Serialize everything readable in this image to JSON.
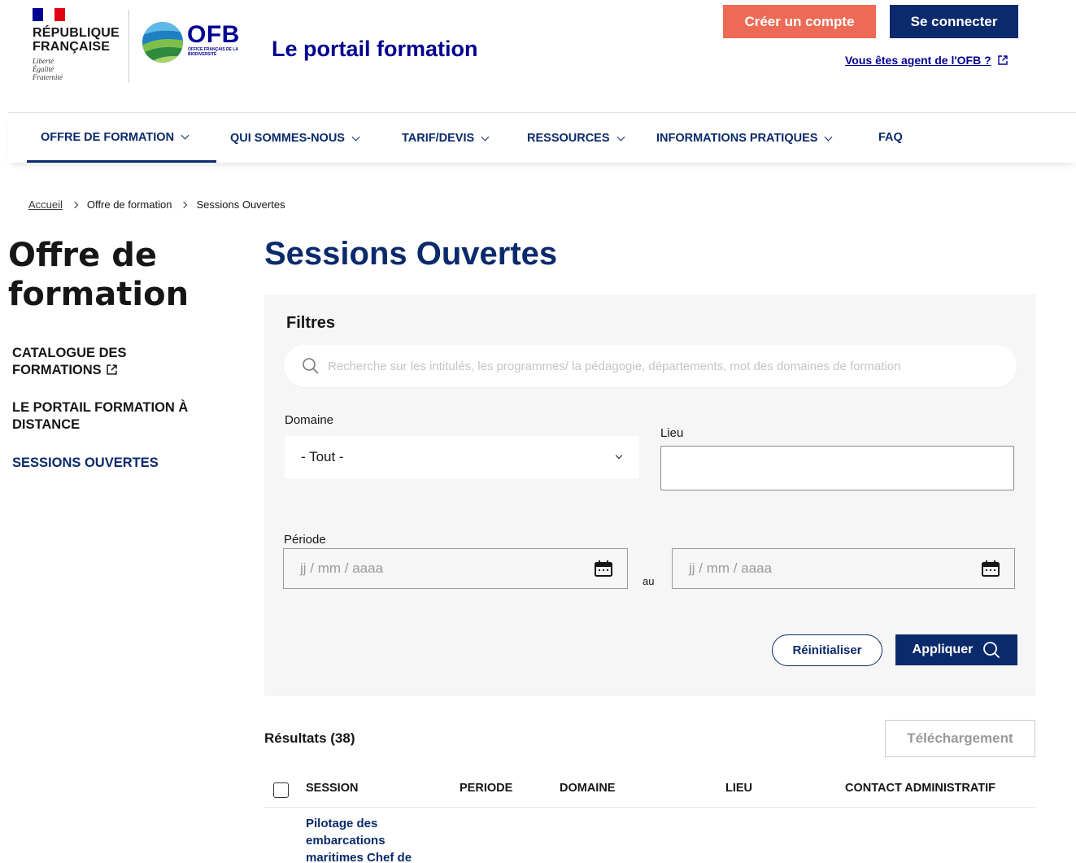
{
  "header": {
    "republique_line1": "RÉPUBLIQUE",
    "republique_line2": "FRANÇAISE",
    "motto_1": "Liberté",
    "motto_2": "Égalité",
    "motto_3": "Fraternité",
    "ofb_logo_text": "OFB",
    "ofb_logo_sub": "Office français de la biodiversité",
    "site_title": "Le portail formation",
    "create_account_label": "Créer un compte",
    "login_label": "Se connecter",
    "agent_link_label": "Vous êtes agent de l'OFB ?"
  },
  "nav": {
    "items": [
      {
        "label": "OFFRE DE FORMATION",
        "has_dropdown": true,
        "active": true
      },
      {
        "label": "QUI SOMMES-NOUS",
        "has_dropdown": true
      },
      {
        "label": "TARIF/DEVIS",
        "has_dropdown": true
      },
      {
        "label": "RESSOURCES",
        "has_dropdown": true
      },
      {
        "label": "INFORMATIONS PRATIQUES",
        "has_dropdown": true
      },
      {
        "label": "FAQ",
        "has_dropdown": false
      }
    ]
  },
  "breadcrumb": {
    "home": "Accueil",
    "level1": "Offre de formation",
    "current": "Sessions Ouvertes"
  },
  "sidebar": {
    "title": "Offre de formation",
    "items": [
      {
        "label": "CATALOGUE DES FORMATIONS",
        "external": true
      },
      {
        "label": "LE PORTAIL FORMATION À DISTANCE"
      },
      {
        "label": "SESSIONS OUVERTES",
        "current": true
      }
    ]
  },
  "main": {
    "title": "Sessions Ouvertes",
    "filters": {
      "title": "Filtres",
      "search_placeholder": "Recherche sur les intitulés, les programmes/ la pédagogie, départements, mot des domaines de formation",
      "domain_label": "Domaine",
      "domain_value": "- Tout -",
      "lieu_label": "Lieu",
      "lieu_value": "",
      "periode_label": "Période",
      "date_from_placeholder": "jj / mm / aaaa",
      "date_to_placeholder": "jj / mm / aaaa",
      "date_separator": "au",
      "reset_label": "Réinitialiser",
      "apply_label": "Appliquer"
    },
    "results": {
      "title": "Résultats (38)",
      "download_label": "Téléchargement",
      "columns": [
        "SESSION",
        "PERIODE",
        "DOMAINE",
        "LIEU",
        "CONTACT ADMINISTRATIF"
      ],
      "rows": [
        {
          "session": "Pilotage des embarcations maritimes Chef de"
        }
      ]
    }
  },
  "colors": {
    "primary_navy": "#0b2a6b",
    "accent_coral": "#ed6b56",
    "panel_bg": "#f6f6f6"
  }
}
